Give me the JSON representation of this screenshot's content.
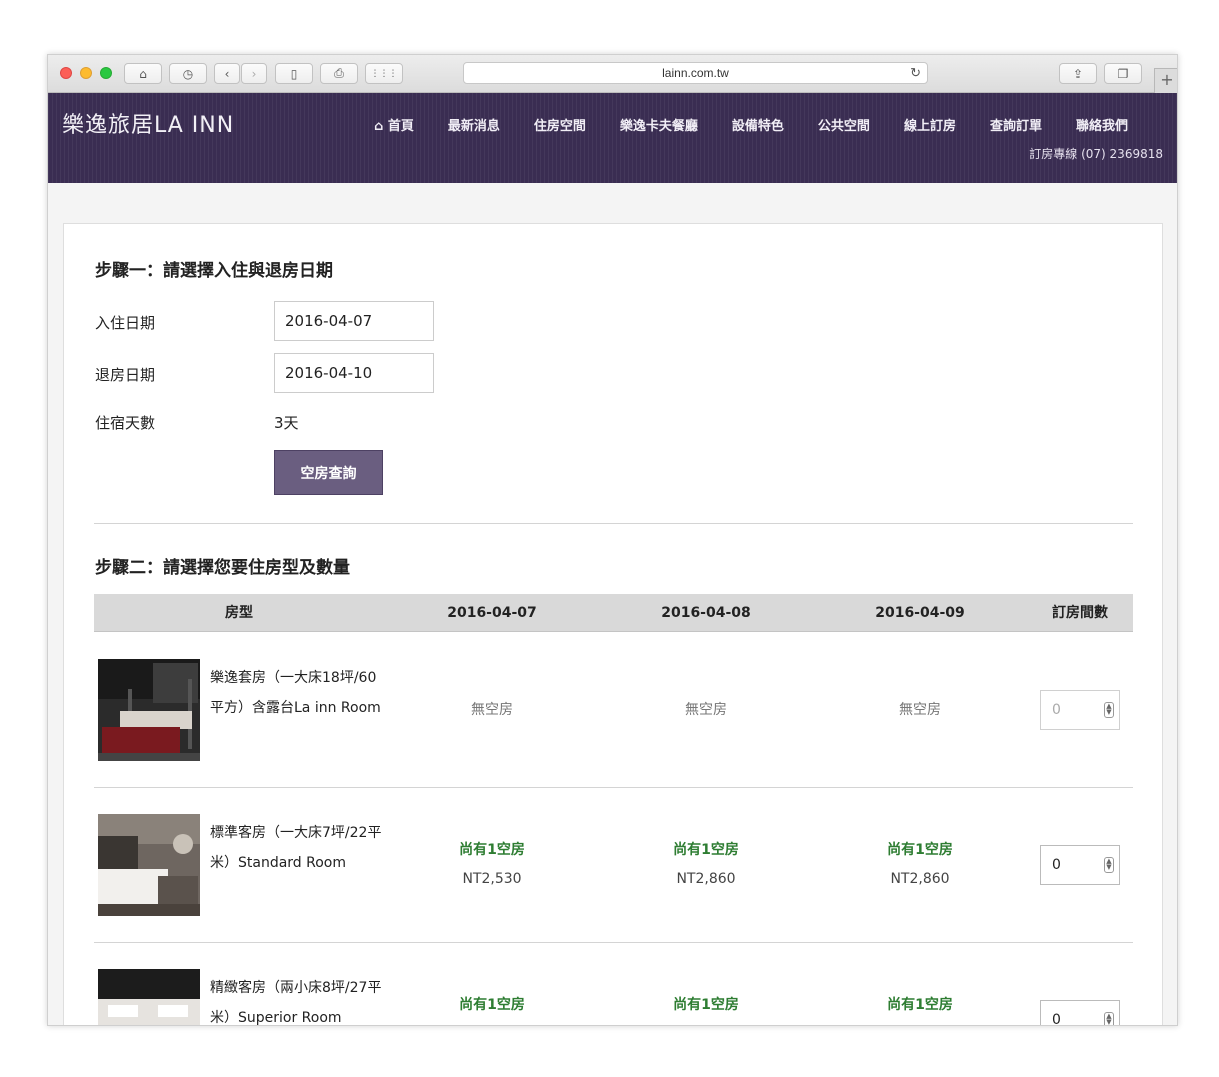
{
  "browser": {
    "url": "lainn.com.tw"
  },
  "header": {
    "logo": "樂逸旅居LA INN",
    "nav": [
      "首頁",
      "最新消息",
      "住房空間",
      "樂逸卡夫餐廳",
      "設備特色",
      "公共空間",
      "線上訂房",
      "查詢訂單",
      "聯絡我們"
    ],
    "hotline": "訂房專線 (07) 2369818",
    "bg_color": "#3a2d52"
  },
  "step1": {
    "title": "步驟一：請選擇入住與退房日期",
    "checkin_label": "入住日期",
    "checkin_value": "2016-04-07",
    "checkout_label": "退房日期",
    "checkout_value": "2016-04-10",
    "nights_label": "住宿天數",
    "nights_value": "3天",
    "search_button": "空房查詢"
  },
  "step2": {
    "title": "步驟二：請選擇您要住房型及數量",
    "columns": [
      "房型",
      "2016-04-07",
      "2016-04-08",
      "2016-04-09",
      "訂房間數"
    ],
    "rooms": [
      {
        "name": "樂逸套房（一大床18坪/60平方）含露台La inn Room",
        "days": [
          {
            "status": "無空房",
            "price": ""
          },
          {
            "status": "無空房",
            "price": ""
          },
          {
            "status": "無空房",
            "price": ""
          }
        ],
        "qty": "0"
      },
      {
        "name": "標準客房（一大床7坪/22平米）Standard Room",
        "days": [
          {
            "status": "尚有1空房",
            "price": "NT2,530"
          },
          {
            "status": "尚有1空房",
            "price": "NT2,860"
          },
          {
            "status": "尚有1空房",
            "price": "NT2,860"
          }
        ],
        "qty": "0"
      },
      {
        "name": "精緻客房（兩小床8坪/27平米）Superior Room",
        "days": [
          {
            "status": "尚有1空房",
            "price": ""
          },
          {
            "status": "尚有1空房",
            "price": ""
          },
          {
            "status": "尚有1空房",
            "price": ""
          }
        ],
        "qty": "0"
      }
    ]
  }
}
